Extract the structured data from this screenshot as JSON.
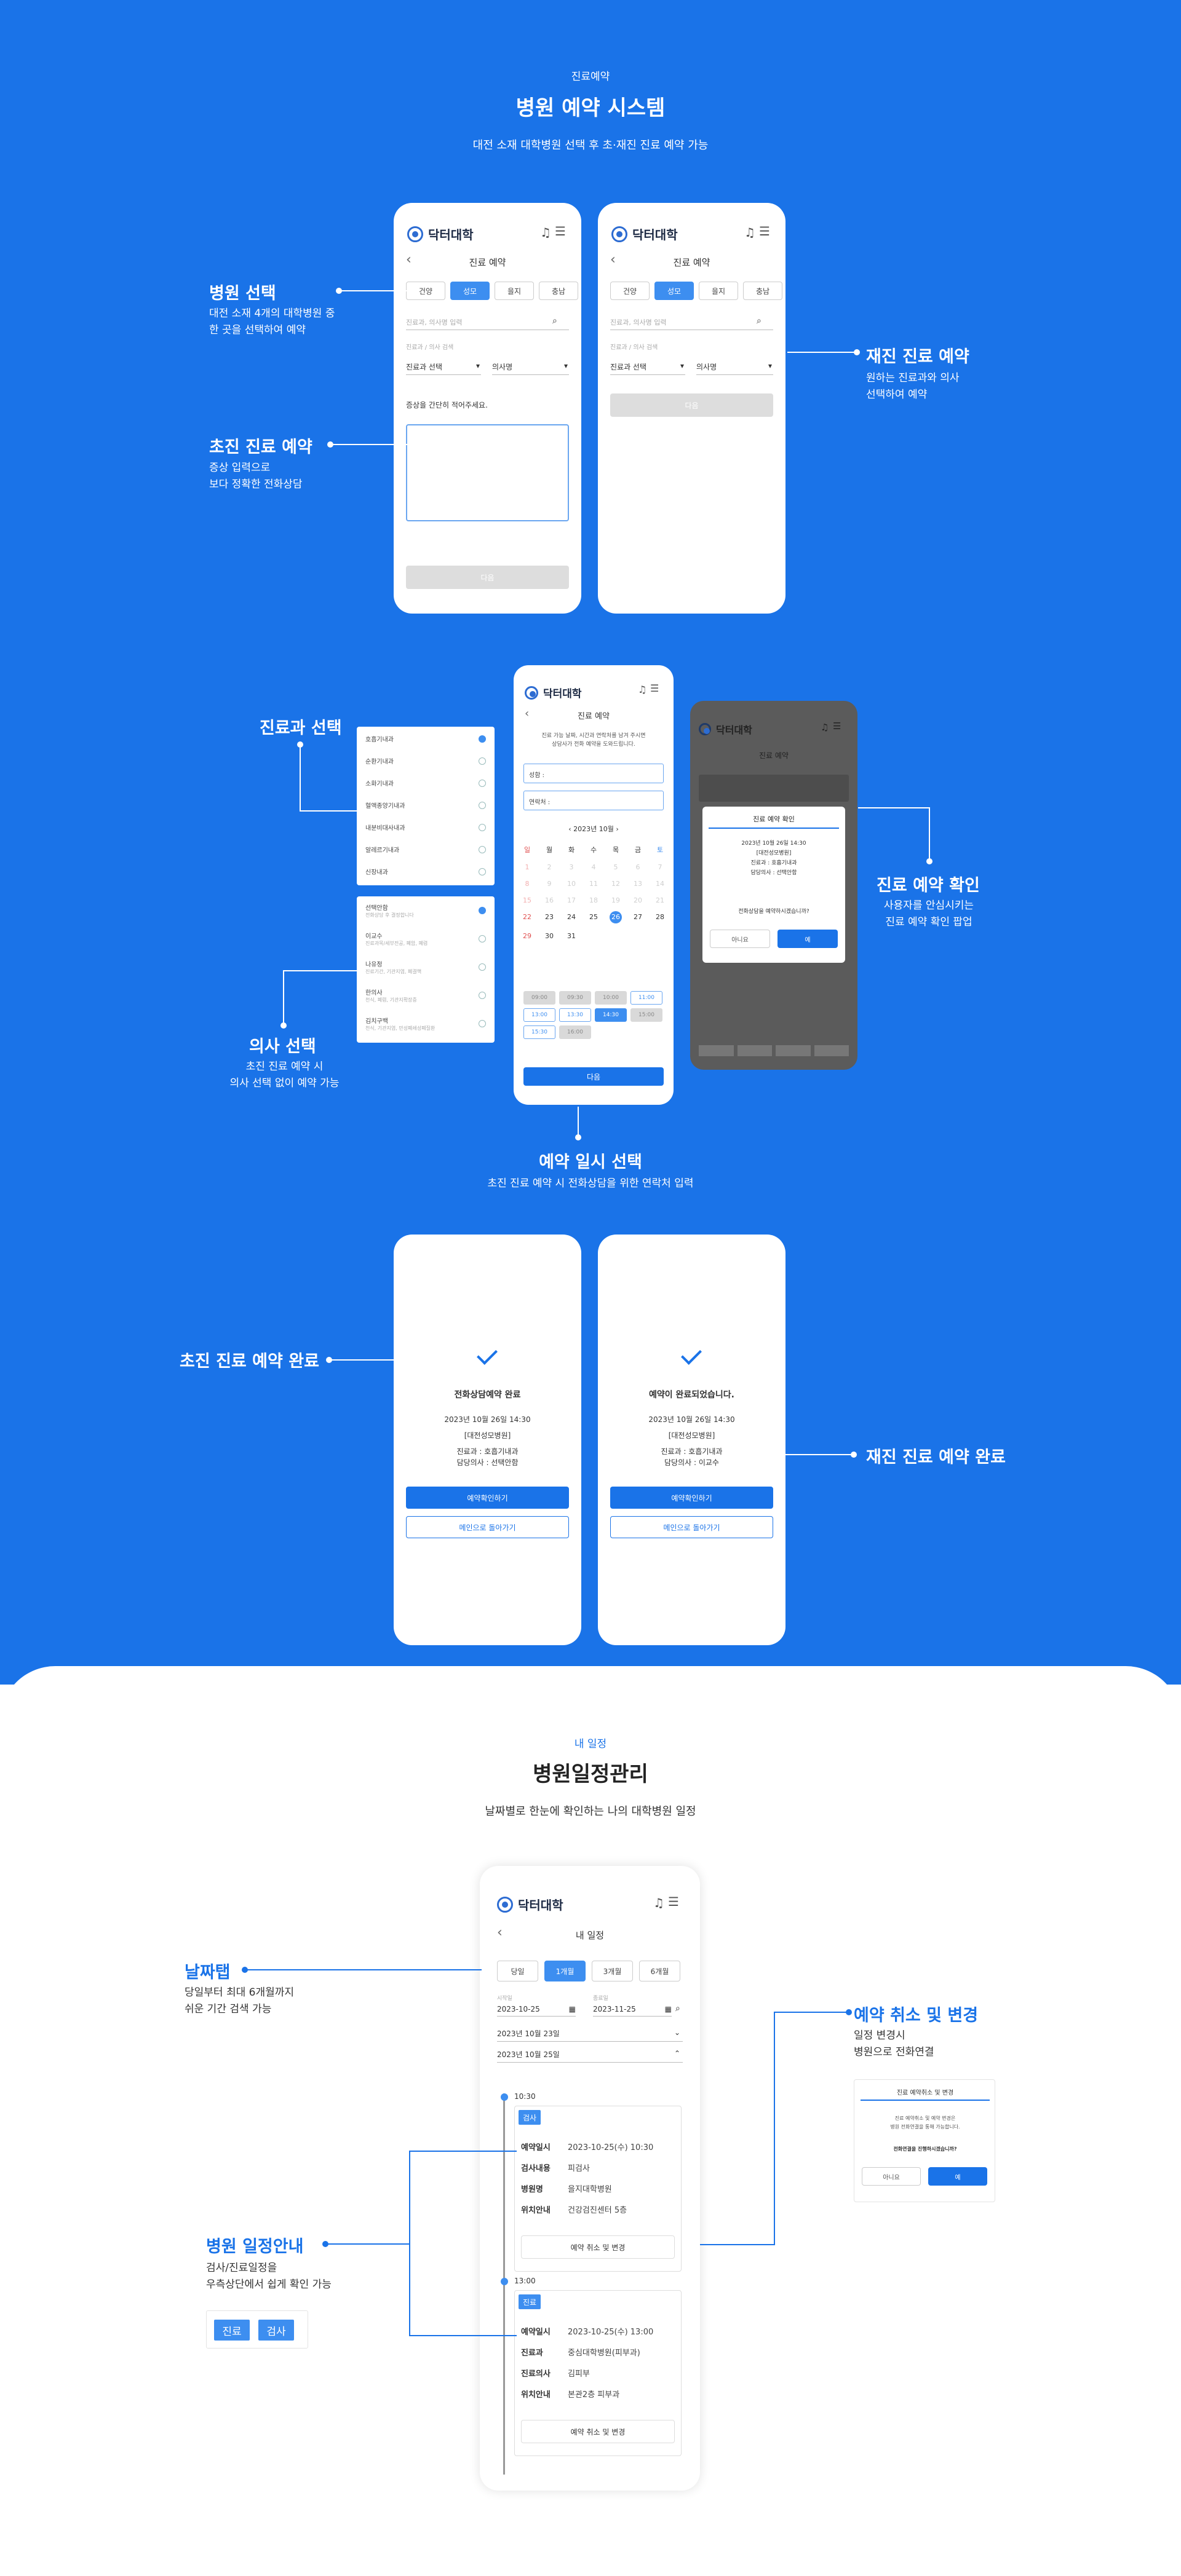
{
  "colors": {
    "primary": "#1a73e8",
    "accent": "#3d8ef0",
    "white": "#ffffff"
  },
  "sec1": {
    "eyebrow": "진료예약",
    "title": "병원 예약 시스템",
    "subtitle": "대전 소재 대학병원 선택 후 초·재진 진료 예약 가능"
  },
  "app": {
    "logo": "닥터대학",
    "bell_icon": "bell-icon",
    "menu_icon": "menu-icon",
    "back_icon": "chevron-left-icon"
  },
  "phoneA": {
    "title": "진료 예약",
    "tabs": [
      "건양",
      "성모",
      "을지",
      "충남"
    ],
    "active_tab": "성모",
    "search_placeholder": "진료과, 의사명 입력",
    "search_icon": "search-icon",
    "filter_label": "진료과 / 의사 검색",
    "select1": "진료과 선택",
    "select2": "의사명",
    "symptom_label": "증상을 간단히 적어주세요.",
    "next": "다음"
  },
  "phoneB": {
    "title": "진료 예약",
    "tabs": [
      "건양",
      "성모",
      "을지",
      "충남"
    ],
    "active_tab": "성모",
    "search_placeholder": "진료과, 의사명 입력",
    "filter_label": "진료과 / 의사 검색",
    "select1": "진료과 선택",
    "select2": "의사명",
    "next": "다음"
  },
  "anno1": {
    "hosp_title": "병원 선택",
    "hosp_desc": [
      "대전 소재 4개의 대학병원 중",
      "한 곳을 선택하여 예약"
    ],
    "first_title": "초진 진료 예약",
    "first_desc": [
      "증상 입력으로",
      "보다 정확한 전화상담"
    ],
    "re_title": "재진 진료 예약",
    "re_desc": [
      "원하는 진료과와 의사",
      "선택하여 예약"
    ]
  },
  "dept_list": [
    "호흡기내과",
    "순환기내과",
    "소화기내과",
    "혈액종양기내과",
    "내분비대사내과",
    "알레르기내과",
    "신장내과"
  ],
  "doctor_list": [
    {
      "name": "선택안함",
      "sub": "전화상담 후 결정합니다"
    },
    {
      "name": "이교수",
      "sub": "진료과목/세부전공, 폐암, 폐렴"
    },
    {
      "name": "나유정",
      "sub": "진료기간, 기관지염, 폐결핵"
    },
    {
      "name": "한의사",
      "sub": "천식, 폐렴, 기관지확장증"
    },
    {
      "name": "김치구백",
      "sub": "천식, 기관지염, 만성폐쇄성폐질환"
    }
  ],
  "phoneC": {
    "title": "진료 예약",
    "notice": [
      "진료 가능 날짜, 시간과 연락처를 남겨 주시면",
      "상담사가 전화 예약을 도와드립니다."
    ],
    "name_label": "성함 :",
    "phone_label": "연락처 :",
    "month": "2023년 10월",
    "weekdays": [
      "일",
      "월",
      "화",
      "수",
      "목",
      "금",
      "토"
    ],
    "days": [
      "1",
      "2",
      "3",
      "4",
      "5",
      "6",
      "7",
      "8",
      "9",
      "10",
      "11",
      "12",
      "13",
      "14",
      "15",
      "16",
      "17",
      "18",
      "19",
      "20",
      "21",
      "22",
      "23",
      "24",
      "25",
      "26",
      "27",
      "28",
      "29",
      "30",
      "31"
    ],
    "selected_day": "26",
    "times": [
      "09:00",
      "09:30",
      "10:00",
      "11:00",
      "13:00",
      "13:30",
      "14:30",
      "15:00",
      "15:30",
      "16:00"
    ],
    "next": "다음"
  },
  "dialog": {
    "title": "진료 예약 확인",
    "date": "2023년 10월 26일 14:30",
    "hospital": "[대전성모병원]",
    "dept": "진료과 : 호흡기내과",
    "doctor": "담당의사 : 선택안함",
    "question": "전화상담을 예약하시겠습니까?",
    "no": "아니요",
    "yes": "예"
  },
  "anno2": {
    "dept_title": "진료과 선택",
    "doctor_title": "의사 선택",
    "doctor_desc": [
      "초진 진료 예약 시",
      "의사 선택 없이 예약 가능"
    ],
    "date_title": "예약 일시 선택",
    "date_desc": "초진 진료 예약 시 전화상담을 위한 연락처 입력",
    "confirm_title": "진료 예약 확인",
    "confirm_desc": [
      "사용자를 안심시키는",
      "진료 예약 확인 팝업"
    ]
  },
  "done1": {
    "title": "전화상담예약 완료",
    "date": "2023년 10월 26일 14:30",
    "hospital": "[대전성모병원]",
    "dept": "진료과 : 호흡기내과",
    "doctor": "담당의사 : 선택안함",
    "btn1": "예약확인하기",
    "btn2": "메인으로 돌아가기"
  },
  "done2": {
    "title": "예약이 완료되었습니다.",
    "date": "2023년 10월 26일 14:30",
    "hospital": "[대전성모병원]",
    "dept": "진료과 : 호흡기내과",
    "doctor": "담당의사 : 이교수",
    "btn1": "예약확인하기",
    "btn2": "메인으로 돌아가기"
  },
  "anno3": {
    "first_done": "초진 진료 예약 완료",
    "re_done": "재진 진료 예약 완료"
  },
  "sec2": {
    "eyebrow": "내 일정",
    "title": "병원일정관리",
    "subtitle": "날짜별로 한눈에 확인하는 나의 대학병원 일정"
  },
  "phoneD": {
    "title": "내 일정",
    "tabs": [
      "당일",
      "1개월",
      "3개월",
      "6개월"
    ],
    "active_tab": "1개월",
    "start_label": "시작일",
    "end_label": "종료일",
    "start": "2023-10-25",
    "end": "2023-11-25",
    "cal_icon": "calendar-icon",
    "search_icon": "search-icon",
    "acc1": "2023년 10월 23일",
    "acc2": "2023년 10월 25일",
    "e1": {
      "time": "10:30",
      "tag": "검사",
      "rows": [
        [
          "예약일시",
          "2023-10-25(수) 10:30"
        ],
        [
          "검사내용",
          "피검사"
        ],
        [
          "병원명",
          "을지대학병원"
        ],
        [
          "위치안내",
          "건강검진센터 5층"
        ]
      ],
      "btn": "예약 취소 및 변경"
    },
    "e2": {
      "time": "13:00",
      "tag": "진료",
      "rows": [
        [
          "예약일시",
          "2023-10-25(수) 13:00"
        ],
        [
          "진료과",
          "중심대학병원(피부과)"
        ],
        [
          "진료의사",
          "김피부"
        ],
        [
          "위치안내",
          "본관2층 피부과"
        ]
      ],
      "btn": "예약 취소 및 변경"
    }
  },
  "anno4": {
    "tab_title": "날짜탭",
    "tab_desc": [
      "당일부터 최대 6개월까지",
      "쉬운 기간 검색 가능"
    ],
    "sched_title": "병원 일정안내",
    "sched_desc": [
      "검사/진료일정을",
      "우측상단에서 쉽게 확인 가능"
    ],
    "tags": [
      "진료",
      "검사"
    ],
    "cancel_title": "예약 취소 및 변경",
    "cancel_desc": [
      "일정 변경시",
      "병원으로 전화연결"
    ]
  },
  "mini_dialog": {
    "title": "진료 예약취소 및 변경",
    "body": [
      "진료 예약취소 및 예약 변경은",
      "병원 전화연결을 통해 가능합니다."
    ],
    "question": "전화연결을 진행하시겠습니까?",
    "no": "아니요",
    "yes": "예"
  }
}
